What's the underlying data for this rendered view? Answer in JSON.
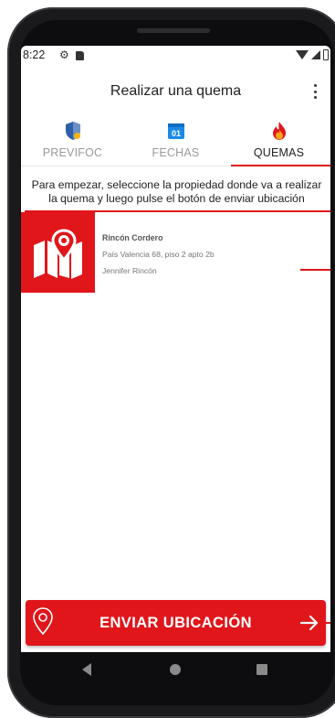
{
  "status_bar": {
    "time": "8:22",
    "icons": [
      "gear-icon",
      "sd-card-icon",
      "wifi-icon",
      "signal-icon",
      "battery-icon"
    ]
  },
  "app_bar": {
    "title": "Realizar una quema",
    "menu_icon": "more-vert-icon"
  },
  "tabs": [
    {
      "label": "PREVIFOC",
      "icon": "shield-icon",
      "active": false
    },
    {
      "label": "FECHAS",
      "icon": "calendar-icon",
      "calendar_day": "01",
      "active": false
    },
    {
      "label": "QUEMAS",
      "icon": "fire-icon",
      "active": true
    }
  ],
  "instructions": "Para empezar, seleccione la propiedad donde va a realizar la quema y luego pulse el botón de enviar ubicación",
  "properties": [
    {
      "name": "Rincón Cordero",
      "address": "País Valencia 68, piso 2 apto 2b",
      "owner": "Jennifer Rincón",
      "icon": "map-pin-icon"
    }
  ],
  "send_button": {
    "label": "ENVIAR UBICACIÓN",
    "left_icon": "location-pin-icon",
    "right_icon": "arrow-right-icon"
  },
  "nav_bar": {
    "icons": [
      "back-icon",
      "home-icon",
      "recents-icon"
    ]
  },
  "colors": {
    "accent": "#e0161b",
    "tab_inactive": "#9a9a9a",
    "shield_blue": "#2f5fa8",
    "shield_gold": "#f5b400",
    "calendar_blue": "#1a8ae6",
    "fire_red": "#e0161b",
    "fire_orange": "#f6a51c"
  }
}
